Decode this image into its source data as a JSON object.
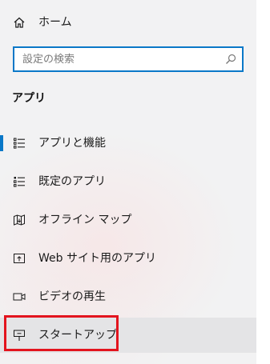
{
  "nav": {
    "home_label": "ホーム",
    "search_placeholder": "設定の検索",
    "section_title": "アプリ",
    "items": [
      {
        "label": "アプリと機能",
        "icon": "apps-features-icon",
        "selected": true
      },
      {
        "label": "既定のアプリ",
        "icon": "default-apps-icon",
        "selected": false
      },
      {
        "label": "オフライン マップ",
        "icon": "offline-maps-icon",
        "selected": false
      },
      {
        "label": "Web サイト用のアプリ",
        "icon": "apps-for-websites-icon",
        "selected": false
      },
      {
        "label": "ビデオの再生",
        "icon": "video-playback-icon",
        "selected": false
      },
      {
        "label": "スタートアップ",
        "icon": "startup-icon",
        "selected": false,
        "highlighted": true
      }
    ]
  },
  "colors": {
    "accent": "#0a78c8",
    "highlight_border": "#e3141e",
    "hover_background": "#e4e4e6"
  }
}
